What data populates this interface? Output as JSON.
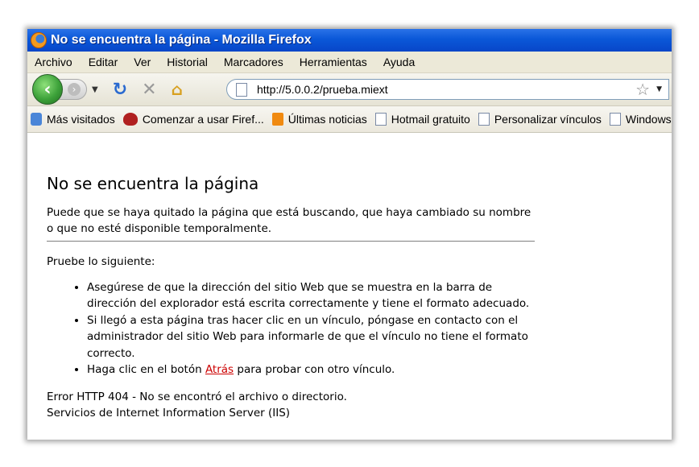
{
  "window": {
    "title": "No se encuentra la página - Mozilla Firefox"
  },
  "menu": [
    "Archivo",
    "Editar",
    "Ver",
    "Historial",
    "Marcadores",
    "Herramientas",
    "Ayuda"
  ],
  "nav": {
    "url": "http://5.0.0.2/prueba.miext"
  },
  "bookmarks": [
    "Más visitados",
    "Comenzar a usar Firef...",
    "Últimas noticias",
    "Hotmail gratuito",
    "Personalizar vínculos",
    "Windows"
  ],
  "page": {
    "heading": "No se encuentra la página",
    "intro": "Puede que se haya quitado la página que está buscando, que haya cambiado su nombre o que no esté disponible temporalmente.",
    "try_label": "Pruebe lo siguiente:",
    "bullets": [
      "Asegúrese de que la dirección del sitio Web que se muestra en la barra de dirección del explorador está escrita correctamente y tiene el formato adecuado.",
      "Si llegó a esta página tras hacer clic en un vínculo, póngase en contacto con el administrador del sitio Web para informarle de que el vínculo no tiene el formato correcto."
    ],
    "back_prefix": "Haga clic en el botón ",
    "back_link": "Atrás",
    "back_suffix": " para probar con otro vínculo.",
    "error_code": "Error HTTP 404 - No se encontró el archivo o directorio.",
    "server": "Servicios de Internet Information Server (IIS)"
  }
}
